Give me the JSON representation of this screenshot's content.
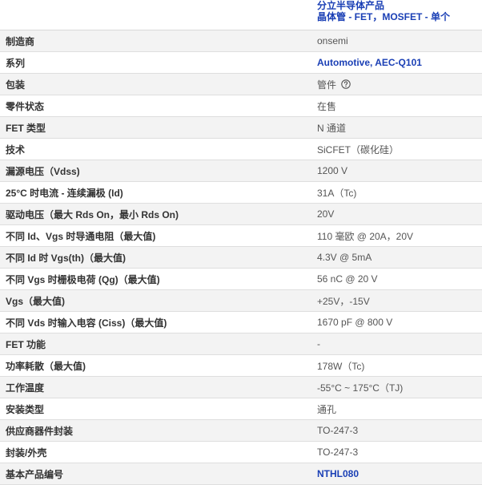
{
  "header": {
    "category_line1": "分立半导体产品",
    "category_line2": "晶体管 - FET，MOSFET - 单个"
  },
  "rows": [
    {
      "label": "制造商",
      "value": "onsemi",
      "link": false
    },
    {
      "label": "系列",
      "value": "Automotive, AEC-Q101",
      "link": true
    },
    {
      "label": "包装",
      "value": "管件",
      "link": false,
      "icon": "help-circle-icon"
    },
    {
      "label": "零件状态",
      "value": "在售",
      "link": false
    },
    {
      "label": "FET 类型",
      "value": "N 通道",
      "link": false
    },
    {
      "label": "技术",
      "value": "SiCFET（碳化硅）",
      "link": false
    },
    {
      "label": "漏源电压（Vdss)",
      "value": "1200 V",
      "link": false
    },
    {
      "label": "25°C 时电流 - 连续漏极 (Id)",
      "value": "31A（Tc)",
      "link": false
    },
    {
      "label": "驱动电压（最大 Rds On，最小 Rds On)",
      "value": "20V",
      "link": false
    },
    {
      "label": "不同 Id、Vgs 时导通电阻（最大值)",
      "value": "110 毫欧 @ 20A，20V",
      "link": false
    },
    {
      "label": "不同 Id 时 Vgs(th)（最大值)",
      "value": "4.3V @ 5mA",
      "link": false
    },
    {
      "label": "不同 Vgs 时栅极电荷 (Qg)（最大值)",
      "value": "56 nC @ 20 V",
      "link": false
    },
    {
      "label": "Vgs（最大值)",
      "value": "+25V，-15V",
      "link": false
    },
    {
      "label": "不同 Vds 时输入电容 (Ciss)（最大值)",
      "value": "1670 pF @ 800 V",
      "link": false
    },
    {
      "label": "FET 功能",
      "value": "-",
      "link": false
    },
    {
      "label": "功率耗散（最大值)",
      "value": "178W（Tc)",
      "link": false
    },
    {
      "label": "工作温度",
      "value": "-55°C ~ 175°C（TJ)",
      "link": false
    },
    {
      "label": "安装类型",
      "value": "通孔",
      "link": false
    },
    {
      "label": "供应商器件封装",
      "value": "TO-247-3",
      "link": false
    },
    {
      "label": "封装/外壳",
      "value": "TO-247-3",
      "link": false
    },
    {
      "label": "基本产品编号",
      "value": "NTHL080",
      "link": true
    }
  ],
  "colors": {
    "link": "#1a3fb5",
    "row_alt": "#f3f3f3",
    "border": "#dedede"
  }
}
